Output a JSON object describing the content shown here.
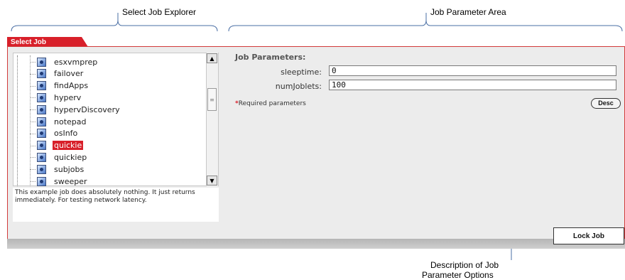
{
  "annotations": {
    "select_job_explorer": "Select Job Explorer",
    "job_parameter_area": "Job Parameter Area",
    "description_options_line1": "Description of Job",
    "description_options_line2": "Parameter Options"
  },
  "tab": {
    "label": "Select Job"
  },
  "explorer": {
    "items": [
      {
        "label": "esxvmprep",
        "selected": false
      },
      {
        "label": "failover",
        "selected": false
      },
      {
        "label": "findApps",
        "selected": false
      },
      {
        "label": "hyperv",
        "selected": false
      },
      {
        "label": "hypervDiscovery",
        "selected": false
      },
      {
        "label": "notepad",
        "selected": false
      },
      {
        "label": "osInfo",
        "selected": false
      },
      {
        "label": "quickie",
        "selected": true
      },
      {
        "label": "quickiep",
        "selected": false
      },
      {
        "label": "subjobs",
        "selected": false
      },
      {
        "label": "sweeper",
        "selected": false
      }
    ],
    "description": "This example job does absolutely nothing. It just returns immediately. For testing network latency."
  },
  "parameters": {
    "heading": "Job Parameters:",
    "fields": [
      {
        "label": "sleeptime:",
        "value": "0"
      },
      {
        "label": "numJoblets:",
        "value": "100"
      }
    ],
    "required_note": "Required parameters",
    "required_star": "*",
    "desc_button": "Desc"
  },
  "actions": {
    "lock_job": "Lock Job"
  },
  "colors": {
    "accent": "#d8202a",
    "panel": "#ececec",
    "annotation_line": "#4a6fa5"
  }
}
